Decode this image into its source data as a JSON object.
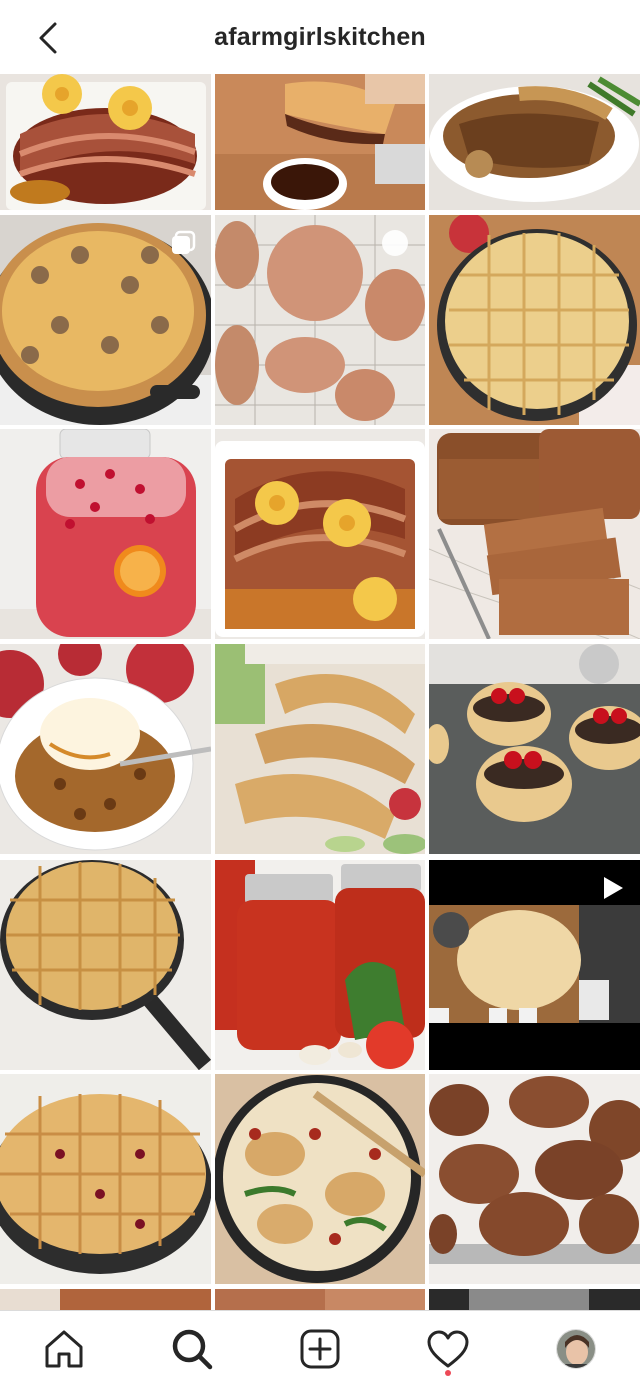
{
  "header": {
    "title": "afarmgirlskitchen",
    "back_icon": "chevron-left-icon"
  },
  "grid": {
    "posts": [
      {
        "name": "post-glazed-ham-pineapple",
        "kind": "photo"
      },
      {
        "name": "post-french-dip-sandwich",
        "kind": "photo"
      },
      {
        "name": "post-pork-chops-gravy",
        "kind": "photo"
      },
      {
        "name": "post-sausage-pizza-skillet",
        "kind": "carousel",
        "badge_icon": "carousel-icon"
      },
      {
        "name": "post-apple-fritters-rack",
        "kind": "carousel",
        "badge_icon": "carousel-icon"
      },
      {
        "name": "post-lattice-apple-pie",
        "kind": "photo"
      },
      {
        "name": "post-cranberry-punch-jar",
        "kind": "photo"
      },
      {
        "name": "post-pineapple-ham-dish",
        "kind": "photo"
      },
      {
        "name": "post-pumpkin-bread-loaf",
        "kind": "photo"
      },
      {
        "name": "post-apple-crisp-ice-cream",
        "kind": "photo"
      },
      {
        "name": "post-hand-pies",
        "kind": "photo"
      },
      {
        "name": "post-cream-puffs-cherries",
        "kind": "photo"
      },
      {
        "name": "post-lattice-pie-skillet",
        "kind": "photo"
      },
      {
        "name": "post-canned-tomato-sauce",
        "kind": "photo"
      },
      {
        "name": "post-pie-dough-video",
        "kind": "video",
        "badge_icon": "play-icon"
      },
      {
        "name": "post-cranberry-lattice-pie",
        "kind": "photo"
      },
      {
        "name": "post-creamy-chicken-skillet",
        "kind": "photo"
      },
      {
        "name": "post-apple-fritters-tray",
        "kind": "photo"
      }
    ]
  },
  "bottom_nav": {
    "items": [
      {
        "name": "home",
        "icon": "home-icon"
      },
      {
        "name": "search",
        "icon": "search-icon"
      },
      {
        "name": "new-post",
        "icon": "add-post-icon"
      },
      {
        "name": "activity",
        "icon": "heart-icon"
      },
      {
        "name": "profile",
        "icon": "avatar"
      }
    ]
  },
  "colors": {
    "text": "#262626",
    "divider": "#dbdbdb",
    "notification": "#ed4956",
    "background": "#ffffff"
  }
}
